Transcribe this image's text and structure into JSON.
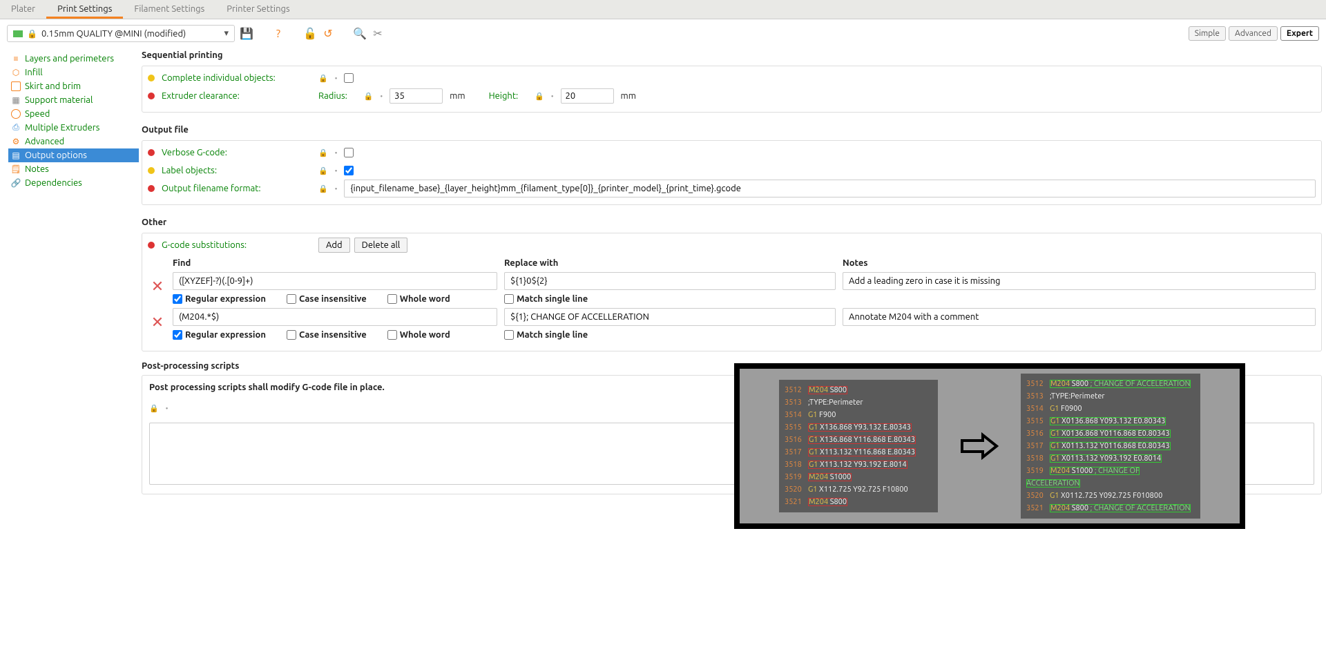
{
  "tabs": {
    "plater": "Plater",
    "print": "Print Settings",
    "filament": "Filament Settings",
    "printer": "Printer Settings"
  },
  "preset": "0.15mm QUALITY @MINI (modified)",
  "modes": {
    "simple": "Simple",
    "advanced": "Advanced",
    "expert": "Expert"
  },
  "sidebar": {
    "layers": "Layers and perimeters",
    "infill": "Infill",
    "skirt": "Skirt and brim",
    "support": "Support material",
    "speed": "Speed",
    "ext": "Multiple Extruders",
    "adv": "Advanced",
    "output": "Output options",
    "notes": "Notes",
    "dep": "Dependencies"
  },
  "sections": {
    "seq": {
      "title": "Sequential printing",
      "complete": "Complete individual objects:",
      "extruder": "Extruder clearance:",
      "radius": "Radius:",
      "radius_val": "35",
      "radius_unit": "mm",
      "height": "Height:",
      "height_val": "20",
      "height_unit": "mm"
    },
    "out": {
      "title": "Output file",
      "verbose": "Verbose G-code:",
      "labelobj": "Label objects:",
      "fname": "Output filename format:",
      "fname_val": "{input_filename_base}_{layer_height}mm_{filament_type[0]}_{printer_model}_{print_time}.gcode"
    },
    "other": {
      "title": "Other",
      "gsub": "G-code substitutions:",
      "add": "Add",
      "delall": "Delete all",
      "h_find": "Find",
      "h_repl": "Replace with",
      "h_notes": "Notes",
      "rows": [
        {
          "find": "([XYZEF]-?)(.[0-9]+)",
          "repl": "${1}0${2}",
          "notes": "Add a leading zero in case it is missing",
          "regex": true,
          "case": false,
          "whole": false,
          "single": false
        },
        {
          "find": "(M204.*$)",
          "repl": "${1}; CHANGE OF ACCELLERATION",
          "notes": "Annotate M204 with a comment",
          "regex": true,
          "case": false,
          "whole": false,
          "single": false
        }
      ],
      "flags": {
        "regex": "Regular expression",
        "case": "Case insensitive",
        "whole": "Whole word",
        "single": "Match single line"
      }
    },
    "pp": {
      "title": "Post-processing scripts",
      "hint": "Post processing scripts shall modify G-code file in place.",
      "value": ""
    }
  },
  "example": {
    "left": [
      {
        "ln": "3512",
        "cmd": "M204",
        "c": "S800",
        "boxr": true
      },
      {
        "ln": "3513",
        "cmd": "",
        "c": ";TYPE:Perimeter"
      },
      {
        "ln": "3514",
        "cmd": "G1",
        "c": "F900"
      },
      {
        "ln": "3515",
        "cmd": "G1",
        "c": "X136.868 Y93.132 E.80343",
        "boxr": true
      },
      {
        "ln": "3516",
        "cmd": "G1",
        "c": "X136.868 Y116.868 E.80343",
        "boxr": true
      },
      {
        "ln": "3517",
        "cmd": "G1",
        "c": "X113.132 Y116.868 E.80343",
        "boxr": true
      },
      {
        "ln": "3518",
        "cmd": "G1",
        "c": "X113.132 Y93.192 E.8014",
        "boxr": true
      },
      {
        "ln": "3519",
        "cmd": "M204",
        "c": "S1000",
        "boxr": true
      },
      {
        "ln": "3520",
        "cmd": "G1",
        "c": "X112.725 Y92.725 F10800"
      },
      {
        "ln": "3521",
        "cmd": "M204",
        "c": "S800",
        "boxr": true
      }
    ],
    "right": [
      {
        "ln": "3512",
        "cmd": "M204",
        "c": "S800",
        "cmt": "; CHANGE OF ACCELERATION",
        "boxg": true
      },
      {
        "ln": "3513",
        "cmd": "",
        "c": ";TYPE:Perimeter"
      },
      {
        "ln": "3514",
        "cmd": "G1",
        "c": "F0900"
      },
      {
        "ln": "3515",
        "cmd": "G1",
        "c": "X0136.868 Y093.132 E0.80343",
        "boxg": true
      },
      {
        "ln": "3516",
        "cmd": "G1",
        "c": "X0136.868 Y0116.868 E0.80343",
        "boxg": true
      },
      {
        "ln": "3517",
        "cmd": "G1",
        "c": "X0113.132 Y0116.868 E0.80343",
        "boxg": true
      },
      {
        "ln": "3518",
        "cmd": "G1",
        "c": "X0113.132 Y093.192 E0.8014",
        "boxg": true
      },
      {
        "ln": "3519",
        "cmd": "M204",
        "c": "S1000",
        "cmt": "; CHANGE OF ACCELERATION",
        "boxg": true
      },
      {
        "ln": "3520",
        "cmd": "G1",
        "c": "X0112.725 Y092.725 F010800"
      },
      {
        "ln": "3521",
        "cmd": "M204",
        "c": "S800",
        "cmt": "; CHANGE OF ACCELERATION",
        "boxg": true
      }
    ]
  }
}
